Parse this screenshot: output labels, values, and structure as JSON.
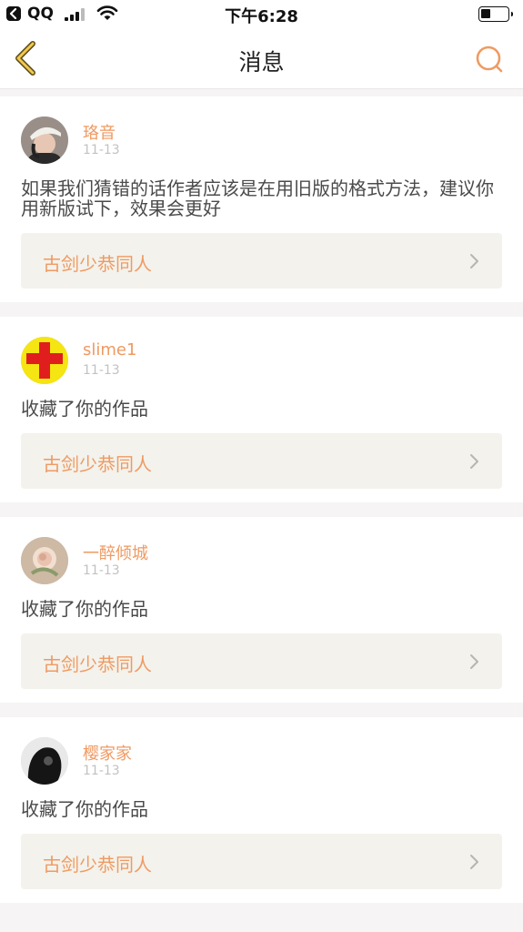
{
  "status_bar": {
    "app": "QQ",
    "time": "下午6:28"
  },
  "nav": {
    "title": "消息",
    "back_icon": "chevron-left-icon",
    "search_icon": "search-icon",
    "accent_color": "#ef9a62"
  },
  "messages": [
    {
      "user": "珞音",
      "date": "11-13",
      "text": "如果我们猜错的话作者应该是在用旧版的格式方法，建议你用新版试下，效果会更好",
      "link": "古剑少恭同人"
    },
    {
      "user": "slime1",
      "date": "11-13",
      "text": "收藏了你的作品",
      "link": "古剑少恭同人"
    },
    {
      "user": "一醉倾城",
      "date": "11-13",
      "text": "收藏了你的作品",
      "link": "古剑少恭同人"
    },
    {
      "user": "樱家家",
      "date": "11-13",
      "text": "收藏了你的作品",
      "link": "古剑少恭同人"
    }
  ]
}
